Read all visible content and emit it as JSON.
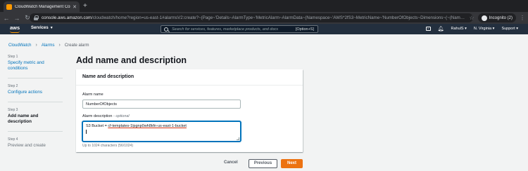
{
  "browser": {
    "tab_title": "CloudWatch Management Con",
    "tab_close": "✕",
    "new_tab": "+",
    "url_host": "console.aws.amazon.com",
    "url_path": "/cloudwatch/home?region=us-east-1#alarmsV2:create?~(Page~'Details~AlarmType~'MetricAlarm~AlarmData~(Namespace~'AWS*2fS3~MetricName~'NumberOfObjects~Dimensions~(~(Nam…",
    "incognito_label": "Incognito (2)"
  },
  "awsnav": {
    "logo": "aws",
    "services": "Services",
    "search_placeholder": "Search for services, features, marketplace products, and docs",
    "search_shortcut": "[Option+S]",
    "user": "RahulS",
    "region": "N. Virginia",
    "support": "Support"
  },
  "breadcrumb": {
    "items": [
      "CloudWatch",
      "Alarms",
      "Create alarm"
    ]
  },
  "steps": [
    {
      "num": "Step 1",
      "label": "Specify metric and conditions"
    },
    {
      "num": "Step 2",
      "label": "Configure actions"
    },
    {
      "num": "Step 3",
      "label": "Add name and description"
    },
    {
      "num": "Step 4",
      "label": "Preview and create"
    }
  ],
  "main": {
    "title": "Add name and description",
    "card_title": "Name and description",
    "alarm_name_label": "Alarm name",
    "alarm_name_value": "NumberOfObjects",
    "desc_label": "Alarm description",
    "desc_optional": "- optional",
    "desc_prefix": "S3 Bucket = ",
    "desc_bucket": "cf-templates-1lpgnp0wh8kfn-us-east-1-bucket",
    "constraint": "Up to 1024 characters (56/1024)"
  },
  "buttons": {
    "cancel": "Cancel",
    "previous": "Previous",
    "next": "Next"
  },
  "colors": {
    "aws_nav_bg": "#232f3e",
    "link": "#0073bb",
    "primary_button": "#ec7211"
  }
}
